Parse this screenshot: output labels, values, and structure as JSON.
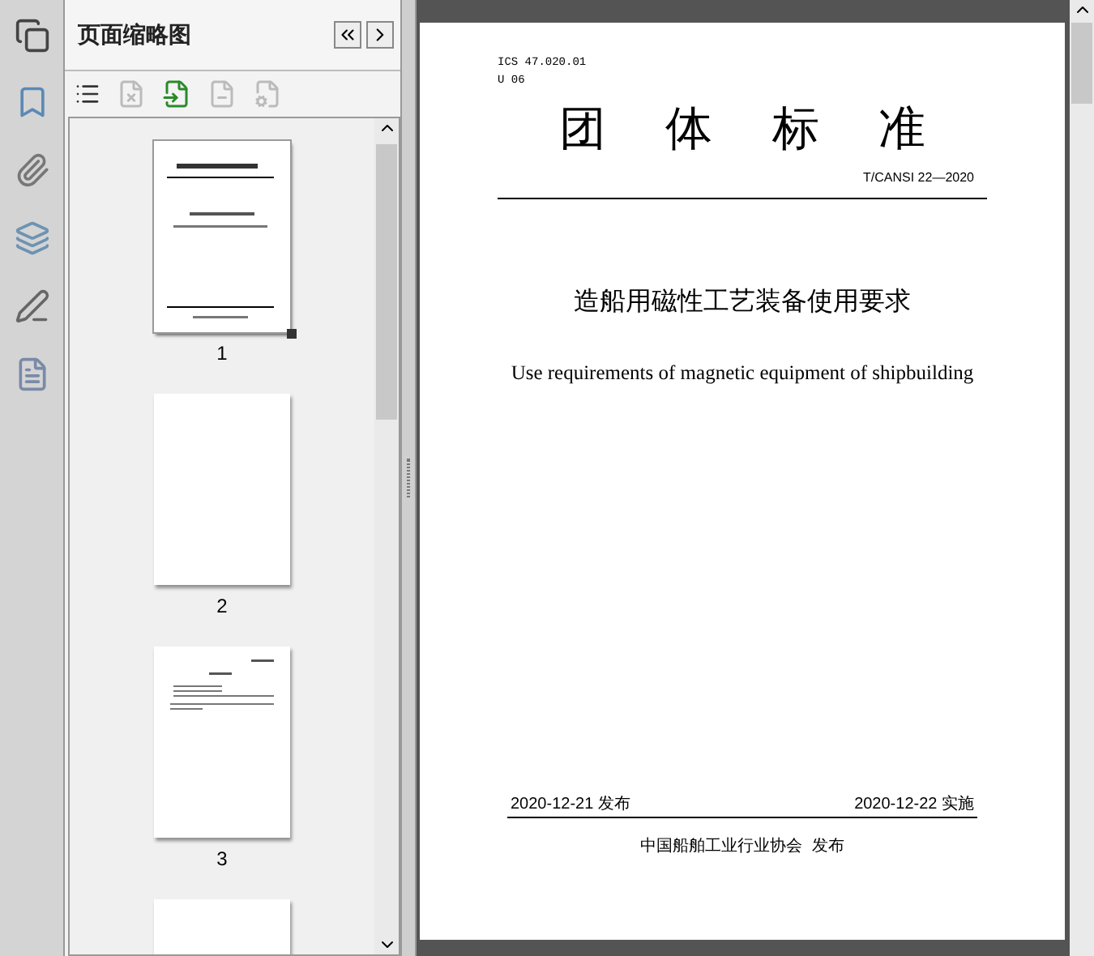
{
  "panel": {
    "title": "页面缩略图"
  },
  "thumbnails": [
    {
      "label": "1",
      "kind": "cover",
      "selected": true
    },
    {
      "label": "2",
      "kind": "blank",
      "selected": false
    },
    {
      "label": "3",
      "kind": "text",
      "selected": false
    },
    {
      "kind": "blank",
      "selected": false
    }
  ],
  "document": {
    "classification": [
      "ICS 47.020.01",
      "U 06"
    ],
    "title_chars": [
      "团",
      "体",
      "标",
      "准"
    ],
    "code": "T/CANSI 22—2020",
    "title_zh": "造船用磁性工艺装备使用要求",
    "title_en": "Use requirements of magnetic equipment of shipbuilding",
    "issue_date": "2020-12-21 发布",
    "effective_date": "2020-12-22 实施",
    "publisher": "中国船舶工业行业协会  发布"
  }
}
